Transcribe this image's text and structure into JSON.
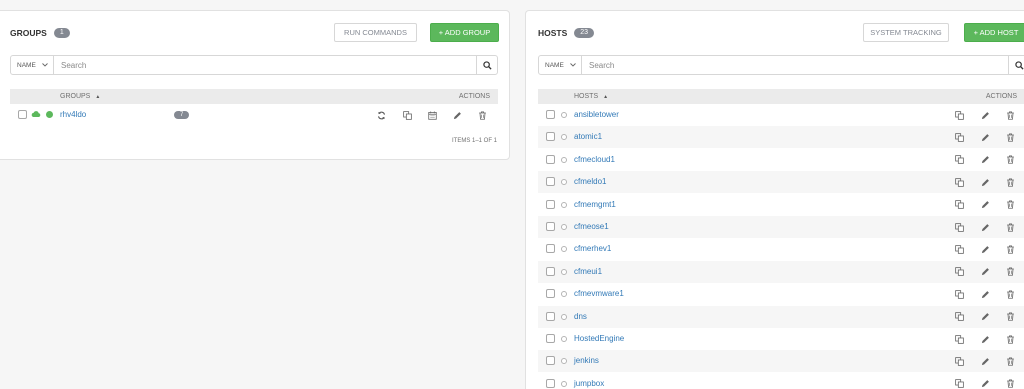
{
  "groups": {
    "title": "GROUPS",
    "count": "1",
    "run_commands_label": "RUN COMMANDS",
    "add_label": "+ ADD GROUP",
    "search": {
      "key": "NAME",
      "placeholder": "Search"
    },
    "table": {
      "col_name": "GROUPS",
      "col_actions": "ACTIONS"
    },
    "rows": [
      {
        "name": "rhv4ldo",
        "hosts_count": "7"
      }
    ],
    "items_label": "ITEMS 1–1 OF 1"
  },
  "hosts": {
    "title": "HOSTS",
    "count": "23",
    "system_tracking_label": "SYSTEM TRACKING",
    "add_label": "+ ADD HOST",
    "search": {
      "key": "NAME",
      "placeholder": "Search"
    },
    "table": {
      "col_name": "HOSTS",
      "col_actions": "ACTIONS"
    },
    "rows": [
      "ansibletower",
      "atomic1",
      "cfmecloud1",
      "cfmeldo1",
      "cfmemgmt1",
      "cfmeose1",
      "cfmerhev1",
      "cfmeui1",
      "cfmevmware1",
      "dns",
      "HostedEngine",
      "jenkins",
      "jumpbox"
    ]
  },
  "colors": {
    "accent": "#5cb85c",
    "link": "#337ab7",
    "badge": "#848992"
  }
}
